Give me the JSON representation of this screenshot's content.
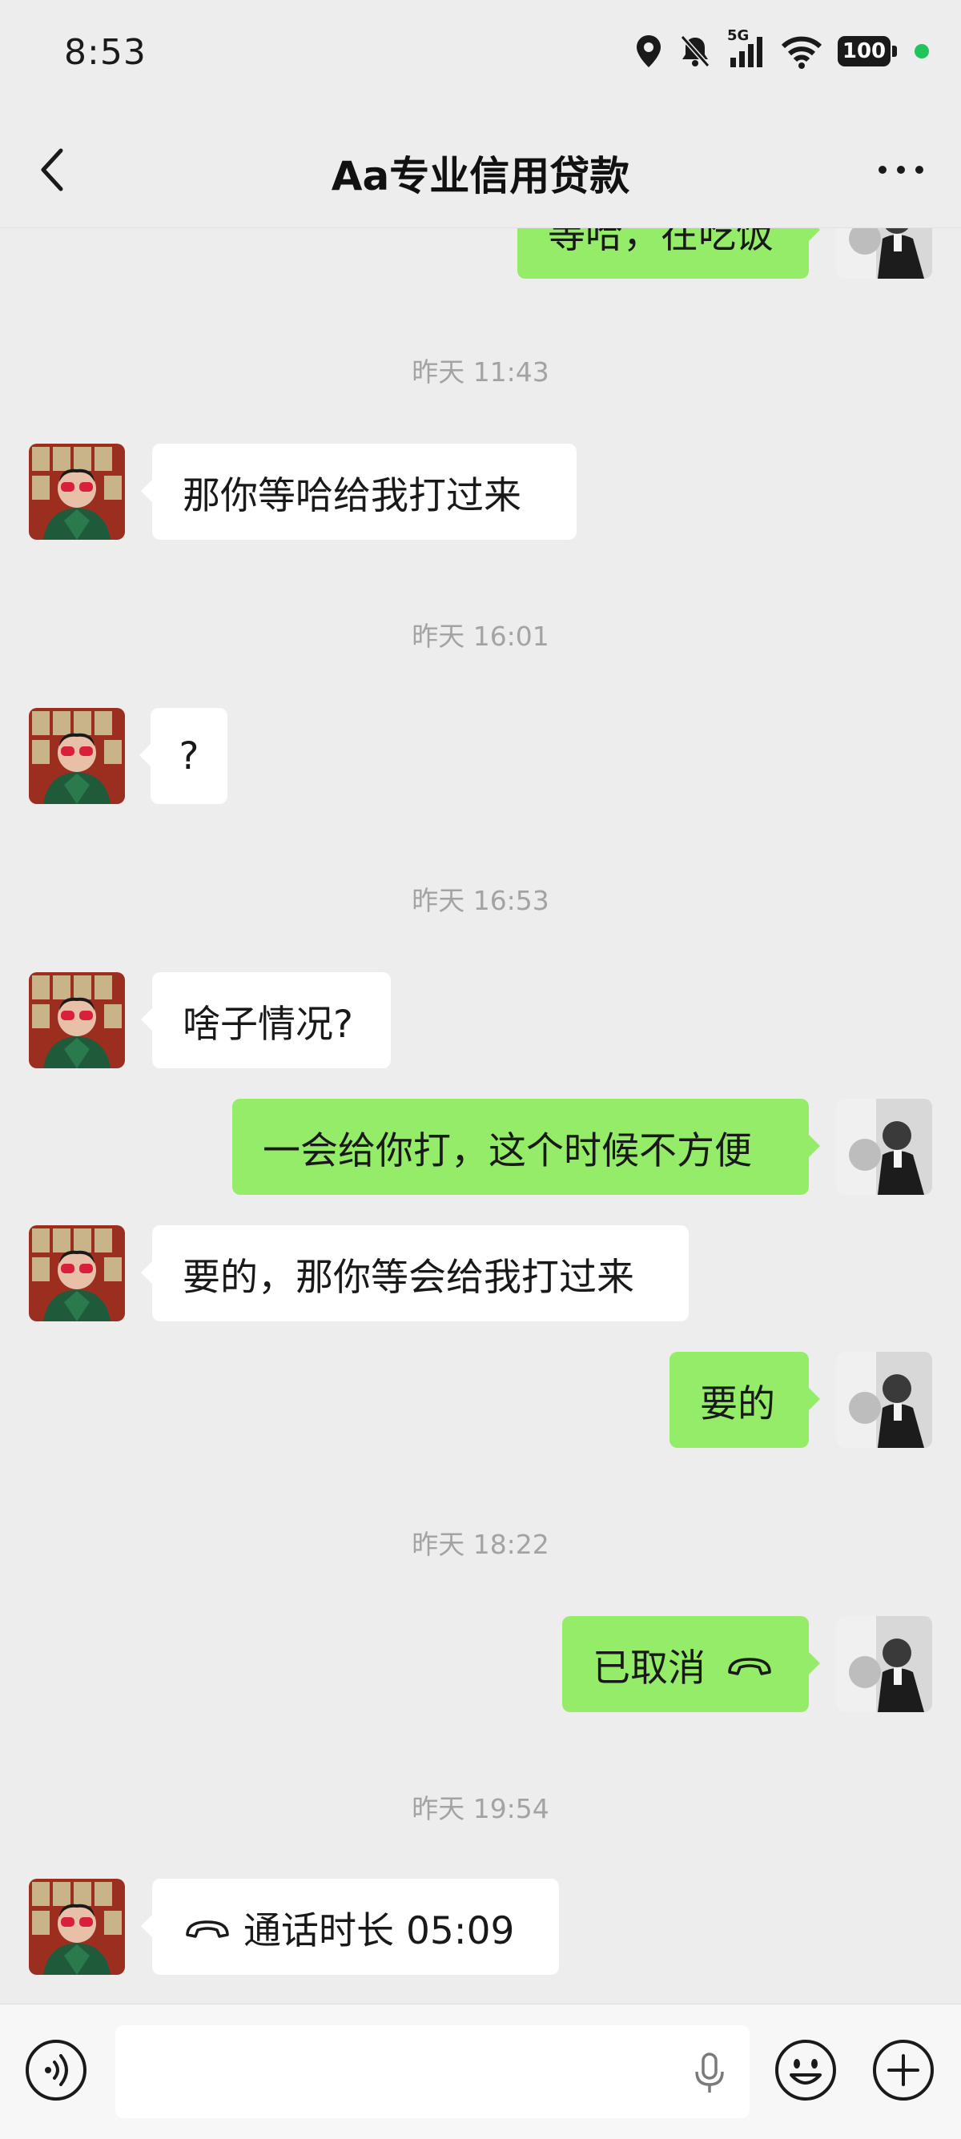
{
  "status_bar": {
    "time": "8:53",
    "network": "5G",
    "battery": "100"
  },
  "header": {
    "title": "Aa专业信用贷款",
    "back_icon": "chevron-left-icon",
    "more_icon": "more-dots-icon"
  },
  "messages": [
    {
      "type": "text",
      "side": "right",
      "text": "等哈，在吃饭"
    },
    {
      "type": "timestamp",
      "text": "昨天 11:43"
    },
    {
      "type": "text",
      "side": "left",
      "text": "那你等哈给我打过来"
    },
    {
      "type": "timestamp",
      "text": "昨天 16:01"
    },
    {
      "type": "text",
      "side": "left",
      "text": "?"
    },
    {
      "type": "timestamp",
      "text": "昨天 16:53"
    },
    {
      "type": "text",
      "side": "left",
      "text": "啥子情况?"
    },
    {
      "type": "text",
      "side": "right",
      "text": "一会给你打，这个时候不方便"
    },
    {
      "type": "text",
      "side": "left",
      "text": "要的，那你等会给我打过来"
    },
    {
      "type": "text",
      "side": "right",
      "text": "要的"
    },
    {
      "type": "timestamp",
      "text": "昨天 18:22"
    },
    {
      "type": "call",
      "side": "right",
      "text": "已取消"
    },
    {
      "type": "timestamp",
      "text": "昨天 19:54"
    },
    {
      "type": "call",
      "side": "left",
      "text": "通话时长 05:09"
    }
  ],
  "input_bar": {
    "voice_icon": "voice-icon",
    "mic_icon": "microphone-icon",
    "emoji_icon": "emoji-icon",
    "plus_icon": "plus-icon"
  },
  "colors": {
    "background": "#ededed",
    "bubble_self": "#95ec69",
    "bubble_other": "#ffffff",
    "timestamp": "#a3a3a3"
  }
}
